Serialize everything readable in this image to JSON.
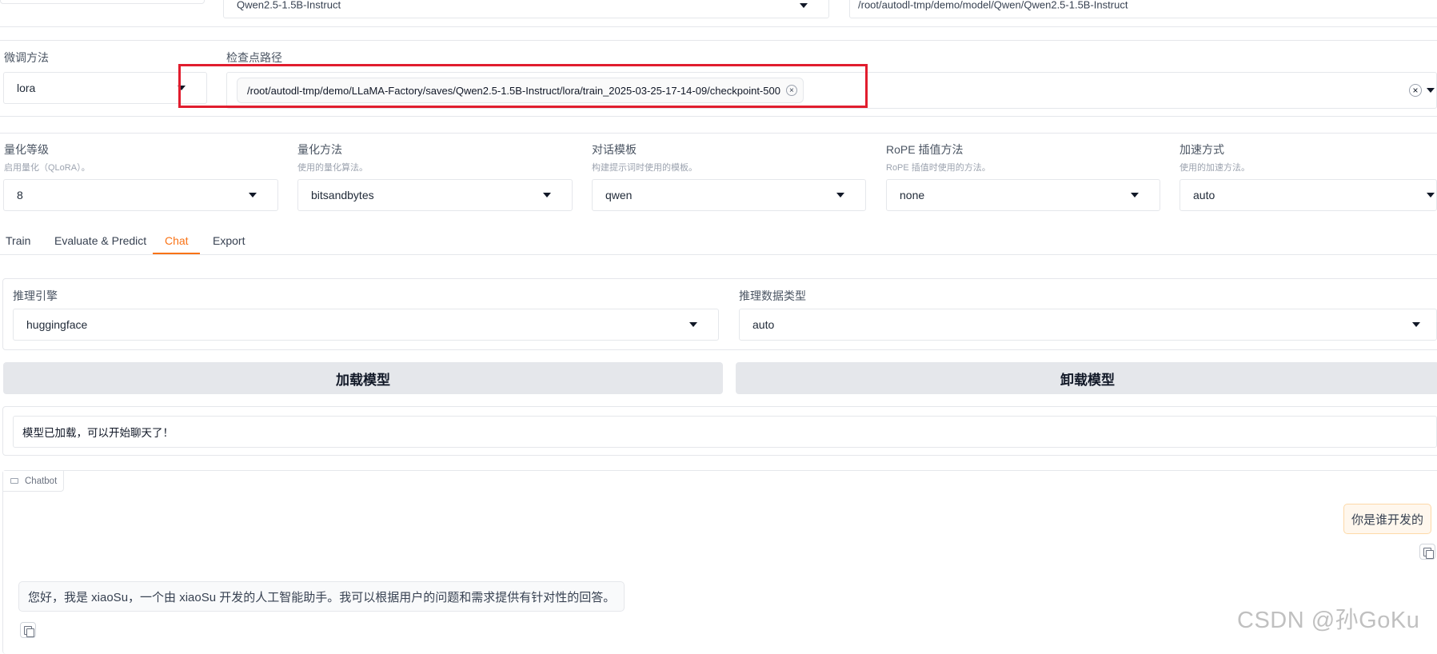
{
  "top": {
    "model_name": "Qwen2.5-1.5B-Instruct",
    "model_path": "/root/autodl-tmp/demo/model/Qwen/Qwen2.5-1.5B-Instruct"
  },
  "finetune": {
    "label": "微调方法",
    "value": "lora"
  },
  "checkpoint": {
    "label": "检查点路径",
    "value": "/root/autodl-tmp/demo/LLaMA-Factory/saves/Qwen2.5-1.5B-Instruct/lora/train_2025-03-25-17-14-09/checkpoint-500",
    "remove_symbol": "×",
    "clear_symbol": "×"
  },
  "settings": [
    {
      "label": "量化等级",
      "info": "启用量化（QLoRA）。",
      "value": "8"
    },
    {
      "label": "量化方法",
      "info": "使用的量化算法。",
      "value": "bitsandbytes"
    },
    {
      "label": "对话模板",
      "info": "构建提示词时使用的模板。",
      "value": "qwen"
    },
    {
      "label": "RoPE 插值方法",
      "info": "RoPE 插值时使用的方法。",
      "value": "none"
    },
    {
      "label": "加速方式",
      "info": "使用的加速方法。",
      "value": "auto"
    }
  ],
  "tabs": [
    {
      "label": "Train",
      "active": false
    },
    {
      "label": "Evaluate & Predict",
      "active": false
    },
    {
      "label": "Chat",
      "active": true
    },
    {
      "label": "Export",
      "active": false
    }
  ],
  "inference": {
    "engine_label": "推理引擎",
    "engine_value": "huggingface",
    "dtype_label": "推理数据类型",
    "dtype_value": "auto"
  },
  "buttons": {
    "load": "加载模型",
    "unload": "卸载模型"
  },
  "status": "模型已加载，可以开始聊天了！",
  "chatbot": {
    "label": "Chatbot",
    "user_message": "你是谁开发的",
    "bot_message": "您好，我是 xiaoSu，一个由 xiaoSu 开发的人工智能助手。我可以根据用户的问题和需求提供有针对性的回答。"
  },
  "watermark": "CSDN @孙GoKu",
  "colors": {
    "accent": "#f97316",
    "highlight": "#e11d2e",
    "user_bubble": "#fff7ed",
    "user_border": "#fdd9a8"
  }
}
